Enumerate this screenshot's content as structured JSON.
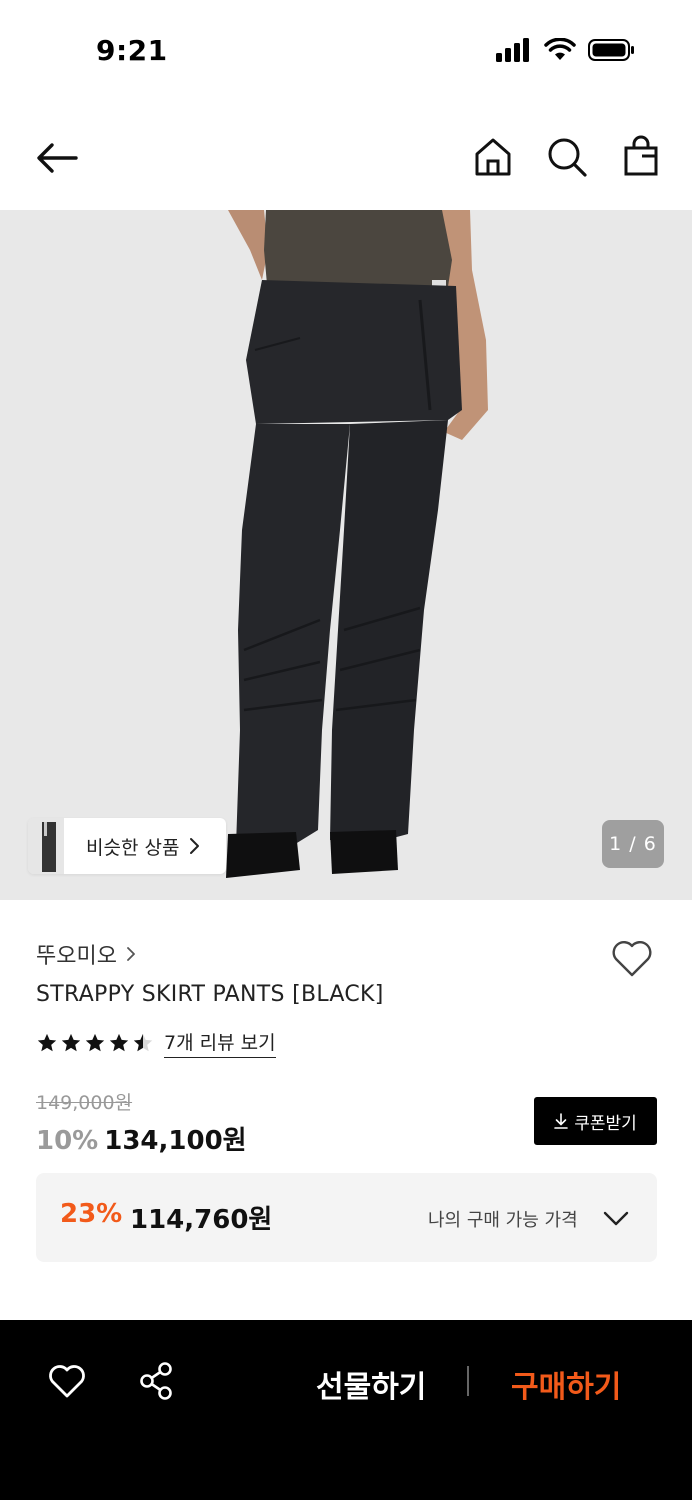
{
  "status_bar": {
    "time": "9:21"
  },
  "nav": {
    "back_icon": "arrow-left-icon",
    "home_icon": "home-icon",
    "search_icon": "search-icon",
    "bag_icon": "shopping-bag-icon"
  },
  "gallery": {
    "similar_label": "비슷한 상품",
    "page_counter": "1 / 6"
  },
  "product": {
    "brand": "뚜오미오",
    "name": "STRAPPY SKIRT PANTS [BLACK]",
    "rating": 4.5,
    "review_link": "7개 리뷰 보기",
    "original_price": "149,000원",
    "discount_rate": "10%",
    "sale_price": "134,100원",
    "coupon_label": "쿠폰받기"
  },
  "best_price": {
    "rate": "23%",
    "price": "114,760원",
    "label": "나의 구매 가능 가격"
  },
  "bottom_bar": {
    "gift_label": "선물하기",
    "buy_label": "구매하기"
  },
  "colors": {
    "accent": "#f25a1a",
    "dark": "#000000"
  }
}
